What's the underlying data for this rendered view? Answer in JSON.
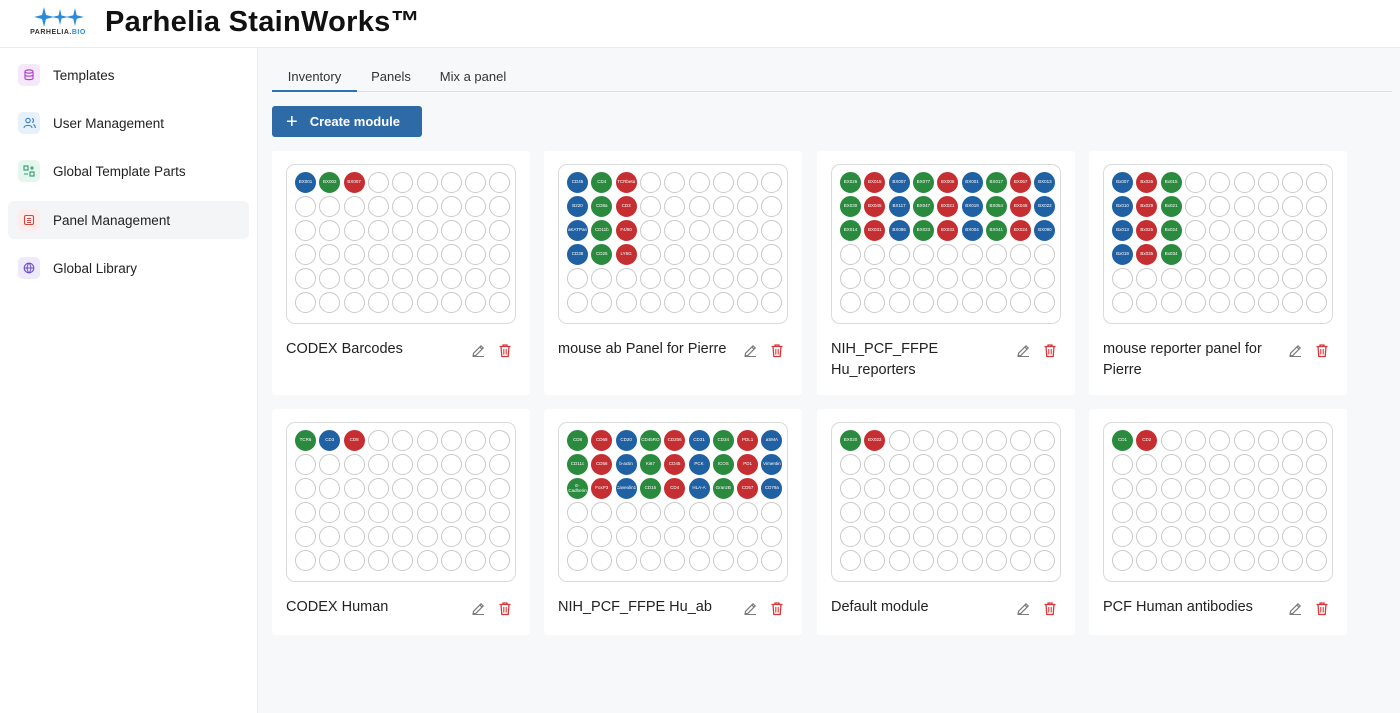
{
  "header": {
    "title": "Parhelia StainWorks™",
    "logo_text_a": "PARHELIA.",
    "logo_text_b": "BIO"
  },
  "sidebar": {
    "items": [
      {
        "label": "Templates",
        "icon": "database-icon",
        "active": false
      },
      {
        "label": "User Management",
        "icon": "users-icon",
        "active": false
      },
      {
        "label": "Global Template Parts",
        "icon": "template-parts-icon",
        "active": false
      },
      {
        "label": "Panel Management",
        "icon": "panel-icon",
        "active": true
      },
      {
        "label": "Global Library",
        "icon": "globe-icon",
        "active": false
      }
    ]
  },
  "tabs": [
    {
      "label": "Inventory",
      "active": true
    },
    {
      "label": "Panels",
      "active": false
    },
    {
      "label": "Mix a panel",
      "active": false
    }
  ],
  "toolbar": {
    "create_label": "Create module"
  },
  "colors": {
    "green": "#2a8a3e",
    "red": "#c62f32",
    "blue": "#2061a4",
    "accent": "#2e6aa6"
  },
  "modules": [
    {
      "name": "CODEX Barcodes",
      "rows": [
        [
          [
            "b",
            "BX001"
          ],
          [
            "g",
            "BX002"
          ],
          [
            "r",
            "BX007"
          ]
        ]
      ]
    },
    {
      "name": "mouse ab Panel for Pierre",
      "rows": [
        [
          [
            "b",
            "CD45"
          ],
          [
            "g",
            "CD4"
          ],
          [
            "r",
            "TCRbeta"
          ]
        ],
        [
          [
            "b",
            "B220"
          ],
          [
            "g",
            "CD8a"
          ],
          [
            "r",
            "CD3"
          ]
        ],
        [
          [
            "b",
            "aKATPan"
          ],
          [
            "g",
            "CD11b"
          ],
          [
            "r",
            "F4/80"
          ]
        ],
        [
          [
            "b",
            "CD38"
          ],
          [
            "g",
            "CD25"
          ],
          [
            "r",
            "LY6G"
          ]
        ]
      ]
    },
    {
      "name": "NIH_PCF_FFPE Hu_reporters",
      "rows": [
        [
          [
            "g",
            "BX026"
          ],
          [
            "r",
            "BX015"
          ],
          [
            "b",
            "BX007"
          ],
          [
            "g",
            "BX077"
          ],
          [
            "r",
            "BX006"
          ],
          [
            "b",
            "BX001"
          ],
          [
            "g",
            "BX017"
          ],
          [
            "r",
            "BX067"
          ],
          [
            "b",
            "BX013"
          ]
        ],
        [
          [
            "g",
            "BX030"
          ],
          [
            "r",
            "BX045"
          ],
          [
            "b",
            "BX117"
          ],
          [
            "g",
            "BX047"
          ],
          [
            "r",
            "BX021"
          ],
          [
            "b",
            "BX019"
          ],
          [
            "g",
            "BX054"
          ],
          [
            "r",
            "BX046"
          ],
          [
            "b",
            "BX022"
          ]
        ],
        [
          [
            "g",
            "BX014"
          ],
          [
            "r",
            "BX031"
          ],
          [
            "b",
            "BX086"
          ],
          [
            "g",
            "BX023"
          ],
          [
            "r",
            "BX033"
          ],
          [
            "b",
            "BX004"
          ],
          [
            "g",
            "BX041"
          ],
          [
            "r",
            "BX024"
          ],
          [
            "b",
            "BX090"
          ]
        ]
      ]
    },
    {
      "name": "mouse reporter panel for Pierre",
      "rows": [
        [
          [
            "b",
            "Bx007"
          ],
          [
            "r",
            "Bx026"
          ],
          [
            "g",
            "Bx015"
          ]
        ],
        [
          [
            "b",
            "Bx010"
          ],
          [
            "r",
            "Bx029"
          ],
          [
            "g",
            "Bx021"
          ]
        ],
        [
          [
            "b",
            "Bx013"
          ],
          [
            "r",
            "Bx025"
          ],
          [
            "g",
            "Bx024"
          ]
        ],
        [
          [
            "b",
            "Bx019"
          ],
          [
            "r",
            "Bx035"
          ],
          [
            "g",
            "Bx034"
          ]
        ]
      ]
    },
    {
      "name": "CODEX Human",
      "rows": [
        [
          [
            "g",
            "TCR6"
          ],
          [
            "b",
            "CD3"
          ],
          [
            "r",
            "CD8"
          ]
        ]
      ]
    },
    {
      "name": "NIH_PCF_FFPE Hu_ab",
      "rows": [
        [
          [
            "g",
            "CD8"
          ],
          [
            "r",
            "CD68"
          ],
          [
            "b",
            "CD20"
          ],
          [
            "g",
            "CD45RO"
          ],
          [
            "r",
            "CD206"
          ],
          [
            "b",
            "CD31"
          ],
          [
            "g",
            "CD34"
          ],
          [
            "r",
            "PDL1"
          ],
          [
            "b",
            "aSMA"
          ]
        ],
        [
          [
            "g",
            "CD11c"
          ],
          [
            "r",
            "CD56"
          ],
          [
            "b",
            "b-actin"
          ],
          [
            "g",
            "Ki67"
          ],
          [
            "r",
            "CD45"
          ],
          [
            "b",
            "PCK"
          ],
          [
            "g",
            "ICOS"
          ],
          [
            "r",
            "PD1"
          ],
          [
            "b",
            "Vimentin"
          ]
        ],
        [
          [
            "g",
            "E-Cadherin"
          ],
          [
            "r",
            "FoxP3"
          ],
          [
            "b",
            "Caveolin1"
          ],
          [
            "g",
            "CD15"
          ],
          [
            "r",
            "CD4"
          ],
          [
            "b",
            "HLA-A"
          ],
          [
            "g",
            "GranzB"
          ],
          [
            "r",
            "CD57"
          ],
          [
            "b",
            "CD79a"
          ]
        ]
      ]
    },
    {
      "name": "Default module",
      "rows": [
        [
          [
            "g",
            "BX020"
          ],
          [
            "r",
            "BX022"
          ]
        ]
      ]
    },
    {
      "name": "PCF Human antibodies",
      "rows": [
        [
          [
            "g",
            "CD1"
          ],
          [
            "r",
            "CD2"
          ]
        ]
      ]
    }
  ]
}
